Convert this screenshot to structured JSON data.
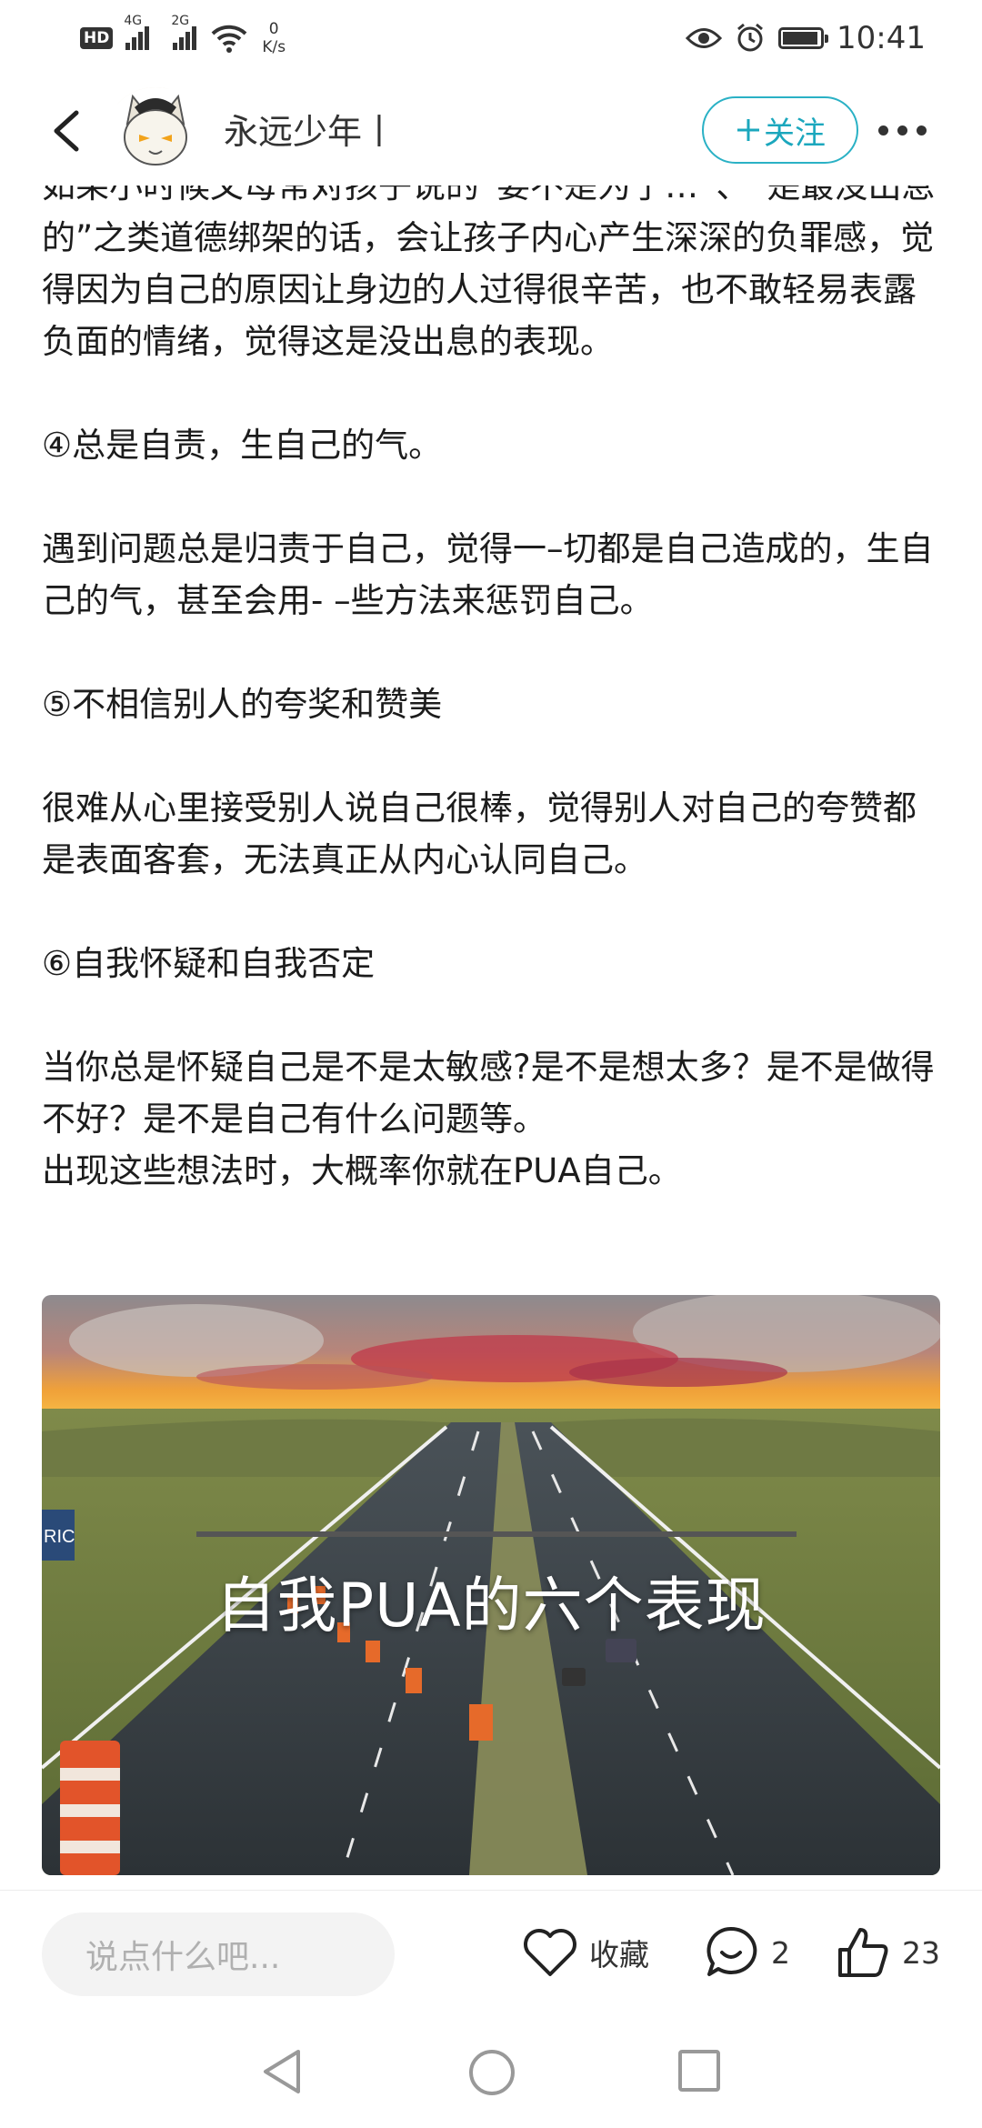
{
  "status_bar": {
    "hd": "HD",
    "sim1": "4G",
    "sim2": "2G",
    "net_speed_value": "0",
    "net_speed_unit": "K/s",
    "time": "10:41"
  },
  "header": {
    "author_name": "永远少年丨",
    "follow_label": "关注"
  },
  "article": {
    "paragraphs": [
      "如果小时候父母常对孩子说的“要不是为了…”、“是最没出息的”之类道德绑架的话，会让孩子内心产生深深的负罪感，觉得因为自己的原因让身边的人过得很辛苦，也不敢轻易表露负面的情绪，觉得这是没出息的表现。",
      "④总是自责，生自己的气。",
      "遇到问题总是归责于自己，觉得一–切都是自己造成的，生自己的气，甚至会用- –些方法来惩罚自己。",
      "⑤不相信别人的夸奖和赞美",
      "很难从心里接受别人说自己很棒，觉得别人对自己的夸赞都是表面客套，无法真正从内心认同自己。",
      "⑥自我怀疑和自我否定",
      "当你总是怀疑自己是不是太敏感?是不是想太多？是不是做得不好？是不是自己有什么问题等。",
      "出现这些想法时，大概率你就在PUA自己。"
    ]
  },
  "image_card": {
    "caption": "自我PUA的六个表现",
    "sign_text": "RIC"
  },
  "bottom_bar": {
    "comment_placeholder": "说点什么吧...",
    "collect_label": "收藏",
    "comment_count": "2",
    "like_count": "23"
  },
  "colors": {
    "accent": "#2ab1c5",
    "text": "#1c1c1c",
    "input_bg": "#f3f3f3"
  }
}
